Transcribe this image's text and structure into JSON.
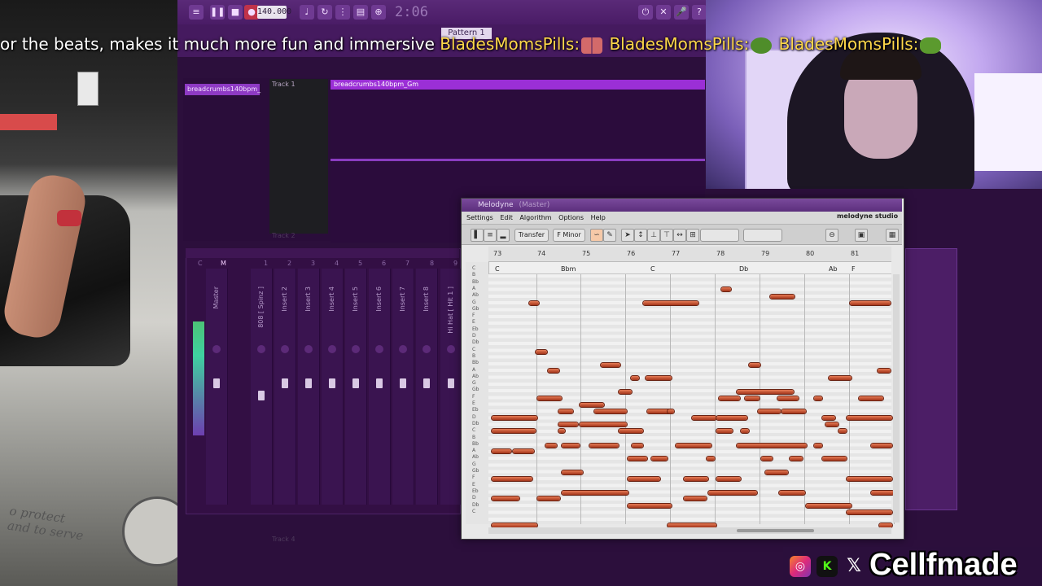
{
  "caption": {
    "text": "or the beats, makes it much more fun and immersive",
    "users": [
      "BladesMomsPills:",
      "BladesMomsPills:",
      "BladesMomsPills:"
    ]
  },
  "daw": {
    "tempo": "140.000",
    "time": "2:06",
    "pattern": "Pattern 1",
    "playlist": {
      "clip_list_item": "breadcrumbs140bpm_",
      "track1": "Track 1",
      "track2": "Track 2",
      "track4": "Track 4",
      "audio_clip": "breadcrumbs140bpm_Gm"
    },
    "mixer": {
      "channels": [
        "Master",
        "808 [ Spinz ]",
        "Insert 2",
        "Insert 3",
        "Insert 4",
        "Insert 5",
        "Insert 6",
        "Insert 7",
        "Insert 8",
        "Hi Hat [ Hit 1 ]"
      ],
      "insert_numbers": [
        "C",
        "M",
        "1",
        "2",
        "3",
        "4",
        "5",
        "6",
        "7",
        "8",
        "9"
      ]
    }
  },
  "melodyne": {
    "title": "Melodyne",
    "title_suffix": "(Master)",
    "menus": [
      "Settings",
      "Edit",
      "Algorithm",
      "Options",
      "Help"
    ],
    "brand": "melodyne studio",
    "transfer_label": "Transfer",
    "key_label": "F Minor",
    "bars": [
      "73",
      "74",
      "75",
      "76",
      "77",
      "78",
      "79",
      "80",
      "81"
    ],
    "chords": [
      "C",
      "Bbm",
      "C",
      "Db",
      "Ab",
      "F"
    ],
    "pitch_keys": [
      "C",
      "B",
      "Bb",
      "A",
      "Ab",
      "G",
      "Gb",
      "F",
      "E",
      "Eb",
      "D",
      "Db",
      "C",
      "B",
      "Bb",
      "A",
      "Ab",
      "G",
      "Gb",
      "F",
      "E",
      "Eb",
      "D",
      "Db",
      "C",
      "B",
      "Bb",
      "A",
      "Ab",
      "G",
      "Gb",
      "F",
      "E",
      "Eb",
      "D",
      "Db",
      "C"
    ]
  },
  "street_cam": {
    "door_text": "o protect\nand to serve"
  },
  "socials": {
    "icons": [
      "instagram-icon",
      "kick-icon",
      "x-icon"
    ],
    "handle": "Cellfmade"
  },
  "colors": {
    "accent": "#9b2fd6",
    "note": "#c4502c",
    "username": "#ffd84a"
  }
}
